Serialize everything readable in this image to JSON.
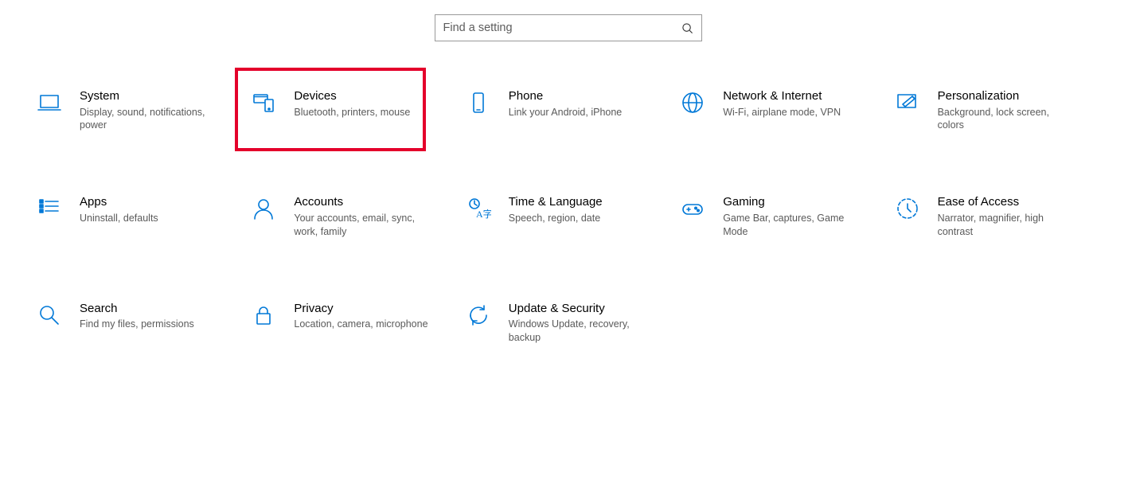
{
  "search": {
    "placeholder": "Find a setting"
  },
  "accent": "#0078D7",
  "highlight_color": "#e4002b",
  "highlight_tile_index": 1,
  "tiles": [
    {
      "id": "system",
      "title": "System",
      "sub": "Display, sound, notifications, power",
      "icon": "laptop"
    },
    {
      "id": "devices",
      "title": "Devices",
      "sub": "Bluetooth, printers, mouse",
      "icon": "devices"
    },
    {
      "id": "phone",
      "title": "Phone",
      "sub": "Link your Android, iPhone",
      "icon": "phone"
    },
    {
      "id": "network",
      "title": "Network & Internet",
      "sub": "Wi-Fi, airplane mode, VPN",
      "icon": "globe"
    },
    {
      "id": "personalization",
      "title": "Personalization",
      "sub": "Background, lock screen, colors",
      "icon": "pen"
    },
    {
      "id": "apps",
      "title": "Apps",
      "sub": "Uninstall, defaults",
      "icon": "apps"
    },
    {
      "id": "accounts",
      "title": "Accounts",
      "sub": "Your accounts, email, sync, work, family",
      "icon": "person"
    },
    {
      "id": "time",
      "title": "Time & Language",
      "sub": "Speech, region, date",
      "icon": "time-lang"
    },
    {
      "id": "gaming",
      "title": "Gaming",
      "sub": "Game Bar, captures, Game Mode",
      "icon": "gamepad"
    },
    {
      "id": "ease",
      "title": "Ease of Access",
      "sub": "Narrator, magnifier, high contrast",
      "icon": "ease"
    },
    {
      "id": "search",
      "title": "Search",
      "sub": "Find my files, permissions",
      "icon": "search-big"
    },
    {
      "id": "privacy",
      "title": "Privacy",
      "sub": "Location, camera, microphone",
      "icon": "lock"
    },
    {
      "id": "update",
      "title": "Update & Security",
      "sub": "Windows Update, recovery, backup",
      "icon": "update"
    }
  ]
}
